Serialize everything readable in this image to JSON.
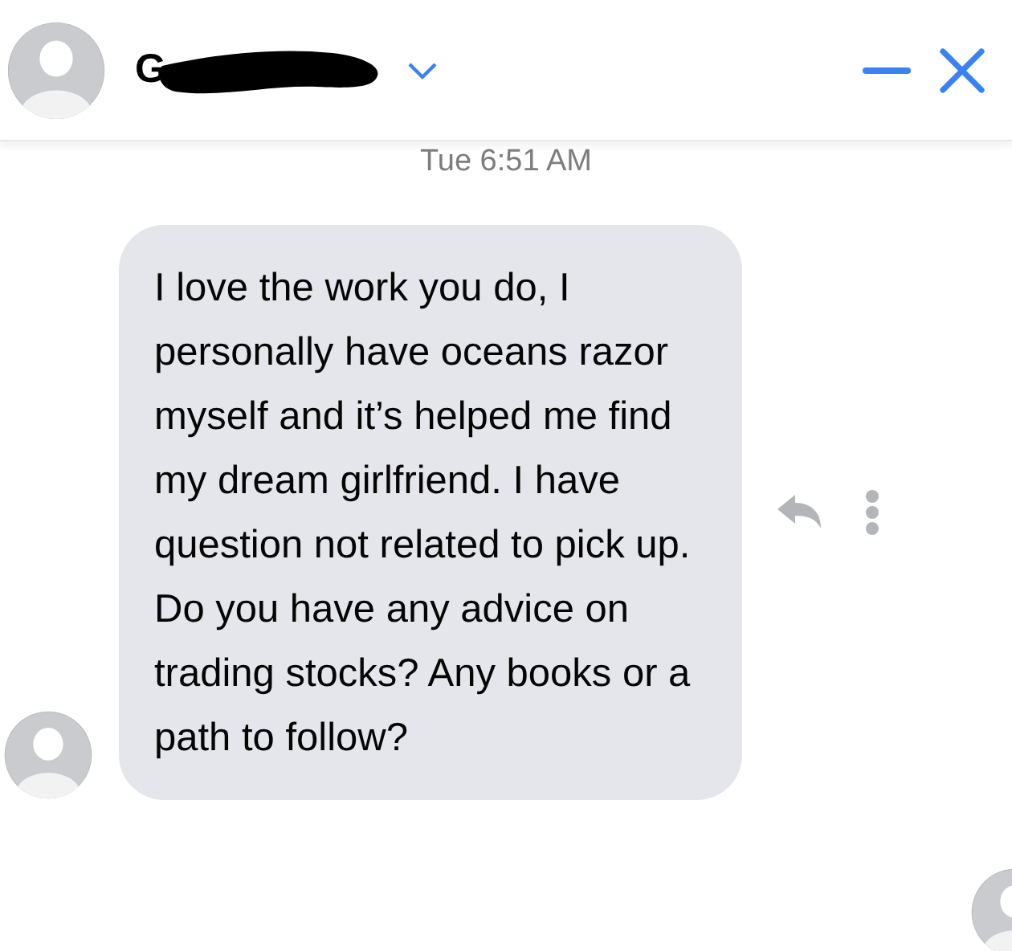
{
  "header": {
    "contact_name": "G",
    "name_redacted": true
  },
  "timestamp": "Tue 6:51 AM",
  "messages": [
    {
      "text": "I love the work you do, I personally have oceans razor myself and it’s helped me find my dream girlfriend. I have question not related to pick up. Do you have any advice on trading stocks? Any books or a path to follow?"
    }
  ]
}
